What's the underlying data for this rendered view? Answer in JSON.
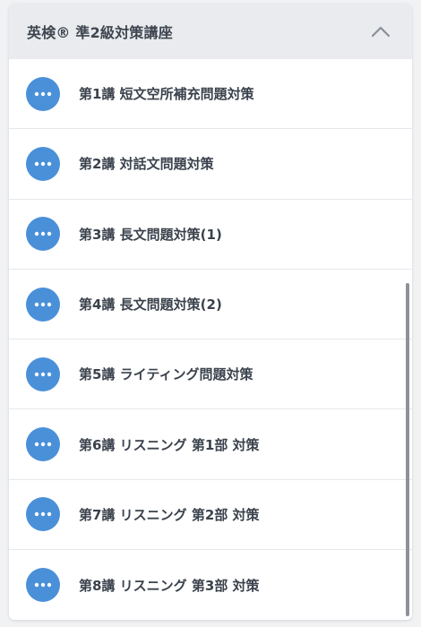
{
  "header": {
    "title": "英検® 準2級対策講座",
    "toggle_icon": "chevron-up-icon"
  },
  "lessons": [
    {
      "label": "第1講 短文空所補充問題対策",
      "icon": "more-dots-icon"
    },
    {
      "label": "第2講 対話文問題対策",
      "icon": "more-dots-icon"
    },
    {
      "label": "第3講 長文問題対策(1)",
      "icon": "more-dots-icon"
    },
    {
      "label": "第4講 長文問題対策(2)",
      "icon": "more-dots-icon"
    },
    {
      "label": "第5講 ライティング問題対策",
      "icon": "more-dots-icon"
    },
    {
      "label": "第6講 リスニング 第1部 対策",
      "icon": "more-dots-icon"
    },
    {
      "label": "第7講 リスニング 第2部 対策",
      "icon": "more-dots-icon"
    },
    {
      "label": "第8講 リスニング 第3部 対策",
      "icon": "more-dots-icon"
    }
  ],
  "colors": {
    "accent": "#4a90d9",
    "header_bg": "#e9ebee",
    "text": "#3b424c"
  }
}
